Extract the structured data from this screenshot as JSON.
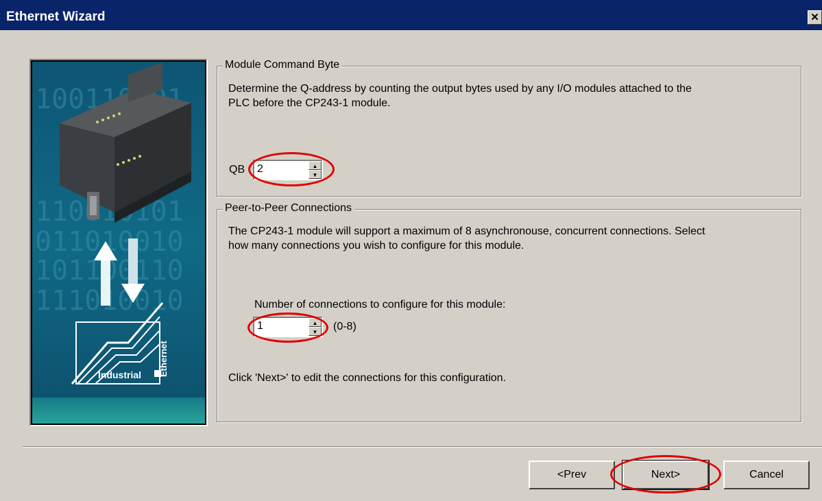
{
  "window": {
    "title": "Ethernet Wizard",
    "close_glyph": "✕"
  },
  "side_image": {
    "industrial_label": "Industrial",
    "ethernet_label": "Ethernet",
    "bg_color": "#0d5a78"
  },
  "module_command_byte": {
    "group_title": "Module Command Byte",
    "description_line1": "Determine the Q-address by counting the output bytes used by any I/O modules attached to the",
    "description_line2": "PLC before the CP243-1 module.",
    "qb_label": "QB",
    "qb_value": "2"
  },
  "peer_to_peer": {
    "group_title": "Peer-to-Peer Connections",
    "description_line1": "The CP243-1 module will support a maximum of 8 asynchronouse, concurrent connections. Select",
    "description_line2": "how many connections you wish to configure for this module.",
    "connections_label": "Number of connections to configure for this module:",
    "connections_value": "1",
    "range_hint": "(0-8)",
    "footer_hint": "Click 'Next>' to edit the connections for this configuration."
  },
  "buttons": {
    "prev": "<Prev",
    "next": "Next>",
    "cancel": "Cancel"
  },
  "highlight_color": "#e00000"
}
